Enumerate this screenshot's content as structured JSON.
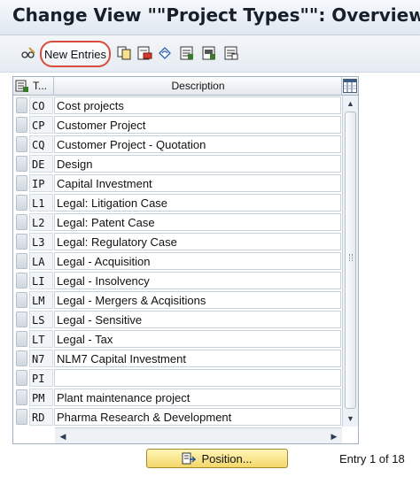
{
  "window": {
    "title": "Change View \"\"Project Types\"\": Overview"
  },
  "toolbar": {
    "new_entries_label": "New Entries",
    "icons": [
      "edit-glasses-icon",
      "copy-icon",
      "delete-icon",
      "undo-icon",
      "select-all-icon",
      "select-block-icon",
      "deselect-all-icon"
    ]
  },
  "table": {
    "columns": {
      "type": "T...",
      "description": "Description"
    },
    "rows": [
      {
        "code": "CO",
        "description": "Cost projects"
      },
      {
        "code": "CP",
        "description": "Customer Project"
      },
      {
        "code": "CQ",
        "description": "Customer Project - Quotation"
      },
      {
        "code": "DE",
        "description": "Design"
      },
      {
        "code": "IP",
        "description": "Capital Investment"
      },
      {
        "code": "L1",
        "description": "Legal: Litigation Case"
      },
      {
        "code": "L2",
        "description": "Legal: Patent Case"
      },
      {
        "code": "L3",
        "description": "Legal: Regulatory Case"
      },
      {
        "code": "LA",
        "description": "Legal - Acquisition"
      },
      {
        "code": "LI",
        "description": "Legal - Insolvency"
      },
      {
        "code": "LM",
        "description": "Legal - Mergers & Acqisitions"
      },
      {
        "code": "LS",
        "description": "Legal - Sensitive"
      },
      {
        "code": "LT",
        "description": "Legal - Tax"
      },
      {
        "code": "N7",
        "description": "NLM7 Capital Investment"
      },
      {
        "code": "PI",
        "description": ""
      },
      {
        "code": "PM",
        "description": "Plant maintenance project"
      },
      {
        "code": "RD",
        "description": "Pharma Research & Development"
      }
    ]
  },
  "footer": {
    "position_label": "Position...",
    "entry_status": "Entry 1 of 18"
  },
  "colors": {
    "highlight_ring": "#d94c3d",
    "position_button": "#f4d76a"
  }
}
